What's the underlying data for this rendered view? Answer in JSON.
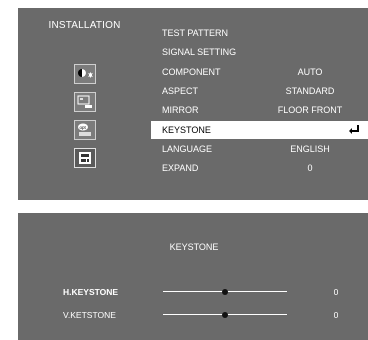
{
  "sidebar": {
    "title": "INSTALLATION",
    "icons": [
      {
        "name": "picture-settings-icon"
      },
      {
        "name": "screen-settings-icon"
      },
      {
        "name": "options-icon"
      },
      {
        "name": "installation-icon"
      }
    ]
  },
  "menu": {
    "items": [
      {
        "label": "TEST PATTERN",
        "value": ""
      },
      {
        "label": "SIGNAL SETTING",
        "value": ""
      },
      {
        "label": "COMPONENT",
        "value": "AUTO"
      },
      {
        "label": "ASPECT",
        "value": "STANDARD"
      },
      {
        "label": "MIRROR",
        "value": "FLOOR FRONT"
      },
      {
        "label": "KEYSTONE",
        "value": ""
      },
      {
        "label": "LANGUAGE",
        "value": "ENGLISH"
      },
      {
        "label": "EXPAND",
        "value": "0"
      }
    ],
    "selected_index": 5
  },
  "keystone_panel": {
    "title": "KEYSTONE",
    "h_keystone": {
      "label": "H.KEYSTONE",
      "value": "0",
      "level": 0.5
    },
    "v_keystone": {
      "label": "V.KETSTONE",
      "value": "0",
      "level": 0.5
    }
  }
}
